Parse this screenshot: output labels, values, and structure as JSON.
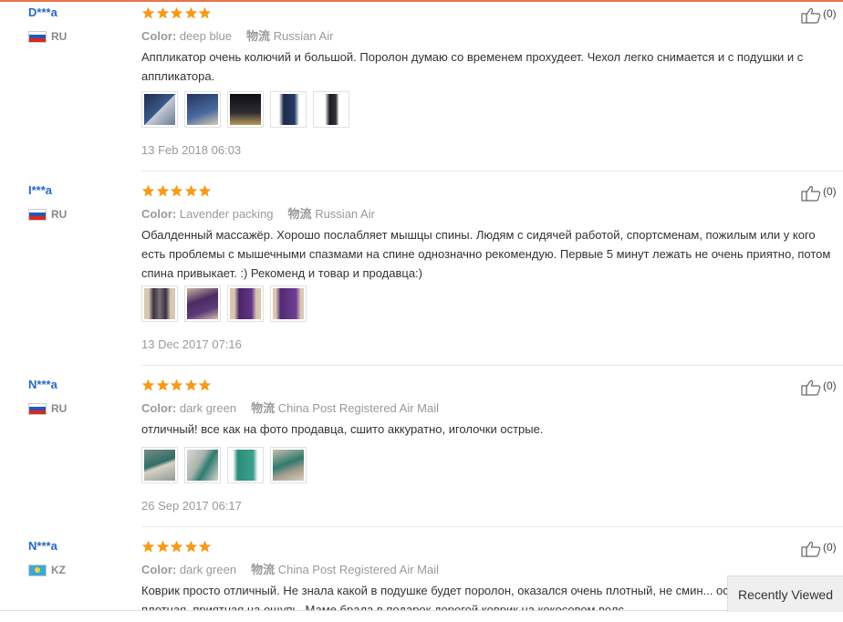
{
  "color_label": "Color:",
  "shipping_label": "物流",
  "reviews": [
    {
      "user": "D***a",
      "country": "RU",
      "rating": 5,
      "color": "deep blue",
      "shipping": "Russian Air",
      "text": "Аппликатор очень колючий и большой. Поролон думаю со временем прохудеет. Чехол легко снимается и с подушки и с аппликатора.",
      "photos": [
        "photo-1",
        "photo-2",
        "photo-3",
        "photo-4",
        "photo-5"
      ],
      "date": "13 Feb 2018 06:03",
      "likes": "(0)"
    },
    {
      "user": "I***a",
      "country": "RU",
      "rating": 5,
      "color": "Lavender packing",
      "shipping": "Russian Air",
      "text": "Обалденный массажёр. Хорошо послабляет мышцы спины. Людям с сидячей работой, спортсменам, пожилым или у кого есть проблемы с мышечными спазмами на спине однозначно рекомендую. Первые 5 минут лежать не очень приятно, потом спина привыкает. :) Рекоменд и товар и продавца:)",
      "photos": [
        "photo-1",
        "photo-2",
        "photo-3",
        "photo-4"
      ],
      "date": "13 Dec 2017 07:16",
      "likes": "(0)"
    },
    {
      "user": "N***a",
      "country": "RU",
      "rating": 5,
      "color": "dark green",
      "shipping": "China Post Registered Air Mail",
      "text": "отличный! все как на фото продавца, сшито аккуратно, иголочки острые.",
      "photos": [
        "photo-1",
        "photo-2",
        "photo-3",
        "photo-4"
      ],
      "date": "26 Sep 2017 06:17",
      "likes": "(0)"
    },
    {
      "user": "N***a",
      "country": "KZ",
      "rating": 5,
      "color": "dark green",
      "shipping": "China Post Registered Air Mail",
      "text": "Коврик просто отличный. Не знала какой в подушке будет поролон, оказался очень плотный, не смин... острые. Ткань плотная, приятная на ощупь. Маме брала в подарок дорогой коврик на кокосовом волс...",
      "photos": [],
      "date": "",
      "likes": "(0)"
    }
  ],
  "recently_viewed": "Recently Viewed",
  "colors": {
    "accent": "#e8734a",
    "username": "#2768c7",
    "star": "#f59a1a",
    "muted": "#999999"
  }
}
